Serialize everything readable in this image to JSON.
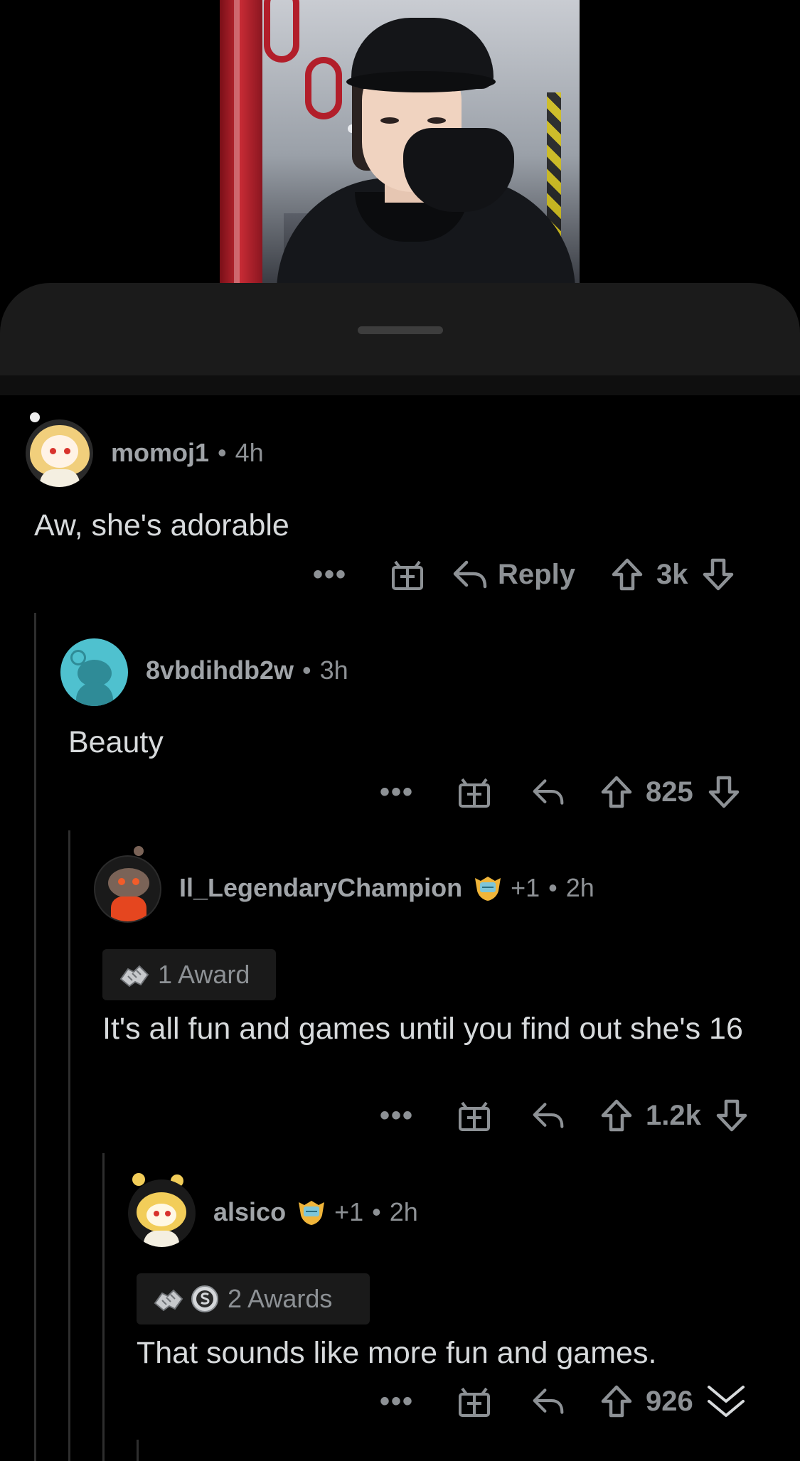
{
  "comments": [
    {
      "username": "momoj1",
      "time": "4h",
      "text": "Aw, she's adorable",
      "reply_label": "Reply",
      "votes": "3k"
    },
    {
      "username": "8vbdihdb2w",
      "time": "3h",
      "text": "Beauty",
      "votes": "825"
    },
    {
      "username": "Il_LegendaryChampion",
      "flair_extra": "+1",
      "time": "2h",
      "awards_label": "1 Award",
      "text": "It's all fun and games until you find out she's 16",
      "votes": "1.2k"
    },
    {
      "username": "alsico",
      "flair_extra": "+1",
      "time": "2h",
      "awards_label": "2 Awards",
      "text": "That sounds like more fun and games.",
      "votes": "926"
    }
  ],
  "separator": "•",
  "more_actions": "•••",
  "colors": {
    "background": "#000000",
    "sheet": "#1b1b1b",
    "text_primary": "#d7dadc",
    "text_secondary": "#8d9195",
    "thread_line": "#2e2e2e"
  },
  "icons": [
    "gift-icon",
    "reply-arrow-icon",
    "upvote-icon",
    "downvote-icon",
    "collapse-chevrons-icon",
    "award-handshake-icon",
    "award-silver-icon",
    "flair-badge-icon"
  ]
}
